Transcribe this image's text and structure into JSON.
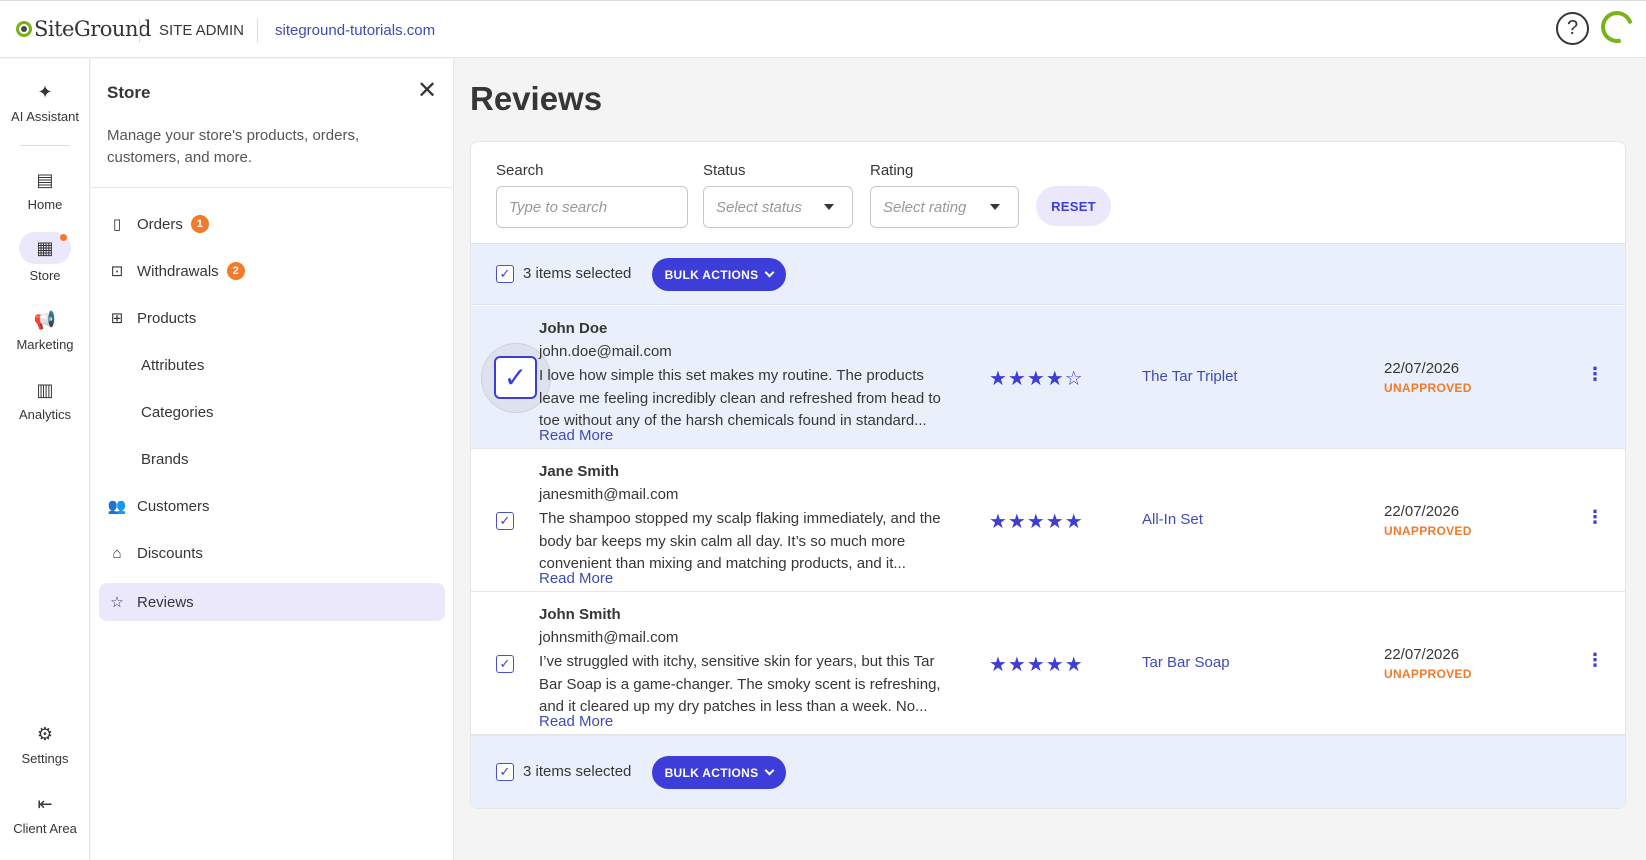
{
  "header": {
    "logo_text": "SiteGround",
    "section": "SITE ADMIN",
    "domain": "siteground-tutorials.com",
    "help_label": "?"
  },
  "rail": {
    "items": [
      {
        "label": "AI Assistant",
        "icon": "sparkle-icon"
      },
      {
        "label": "Home",
        "icon": "home-icon"
      },
      {
        "label": "Store",
        "icon": "store-icon",
        "active": true
      },
      {
        "label": "Marketing",
        "icon": "megaphone-icon"
      },
      {
        "label": "Analytics",
        "icon": "analytics-icon"
      },
      {
        "label": "Settings",
        "icon": "gear-icon"
      },
      {
        "label": "Client Area",
        "icon": "exit-icon"
      }
    ]
  },
  "store": {
    "title": "Store",
    "description": "Manage your store's products, orders, customers, and more.",
    "nav": [
      {
        "label": "Orders",
        "badge": "1"
      },
      {
        "label": "Withdrawals",
        "badge": "2"
      },
      {
        "label": "Products"
      },
      {
        "label": "Attributes"
      },
      {
        "label": "Categories"
      },
      {
        "label": "Brands"
      },
      {
        "label": "Customers"
      },
      {
        "label": "Discounts"
      },
      {
        "label": "Reviews",
        "active": true
      }
    ]
  },
  "main": {
    "title": "Reviews",
    "filters": {
      "search_label": "Search",
      "search_placeholder": "Type to search",
      "status_label": "Status",
      "status_placeholder": "Select status",
      "rating_label": "Rating",
      "rating_placeholder": "Select rating",
      "reset_label": "RESET"
    },
    "bulk": {
      "selected_text": "3 items selected",
      "button_label": "BULK ACTIONS"
    },
    "reviews": [
      {
        "name": "John Doe",
        "email": "john.doe@mail.com",
        "text": "I love how simple this set makes my routine. The products leave me feeling incredibly clean and refreshed from head to toe without any of the harsh chemicals found in standard...",
        "read_more": "Read More",
        "rating": 4,
        "rating_display": "★★★★☆",
        "product": "The Tar Triplet",
        "date": "22/07/2026",
        "status": "UNAPPROVED"
      },
      {
        "name": "Jane Smith",
        "email": "janesmith@mail.com",
        "text": "The shampoo stopped my scalp flaking immediately, and the body bar keeps my skin calm all day. It’s so much more convenient than mixing and matching products, and it...",
        "read_more": "Read More",
        "rating": 5,
        "rating_display": "★★★★★",
        "product": "All-In Set",
        "date": "22/07/2026",
        "status": "UNAPPROVED"
      },
      {
        "name": "John Smith",
        "email": "johnsmith@mail.com",
        "text": "I’ve struggled with itchy, sensitive skin for years, but this Tar Bar Soap is a game-changer. The smoky scent is refreshing, and it cleared up my dry patches in less than a week. No...",
        "read_more": "Read More",
        "rating": 5,
        "rating_display": "★★★★★",
        "product": "Tar Bar Soap",
        "date": "22/07/2026",
        "status": "UNAPPROVED"
      }
    ]
  },
  "colors": {
    "accent": "#3d3dd9",
    "badge": "#f17a2b",
    "brand_green": "#7ab317",
    "selected_bg": "#eaf0fb"
  }
}
